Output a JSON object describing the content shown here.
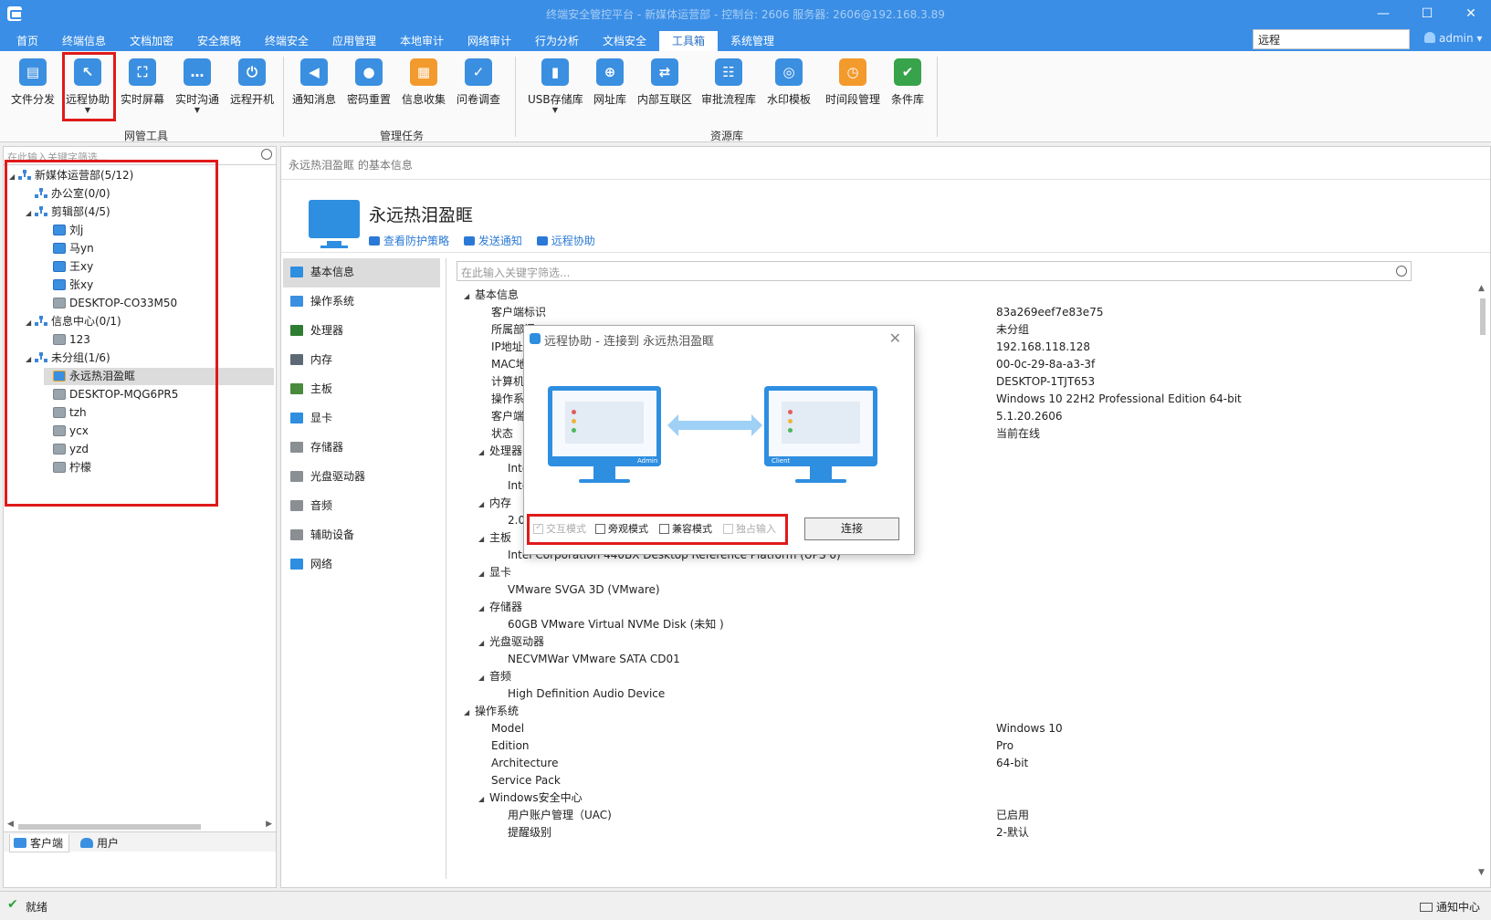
{
  "window": {
    "title": "终端安全管控平台 - 新媒体运营部 - 控制台: 2606 服务器: 2606@192.168.3.89"
  },
  "menu": {
    "tabs": [
      {
        "label": "首页",
        "active": false
      },
      {
        "label": "终端信息",
        "active": false
      },
      {
        "label": "文档加密",
        "active": false
      },
      {
        "label": "安全策略",
        "active": false
      },
      {
        "label": "终端安全",
        "active": false
      },
      {
        "label": "应用管理",
        "active": false
      },
      {
        "label": "本地审计",
        "active": false
      },
      {
        "label": "网络审计",
        "active": false
      },
      {
        "label": "行为分析",
        "active": false
      },
      {
        "label": "文档安全",
        "active": false
      },
      {
        "label": "工具箱",
        "active": true
      },
      {
        "label": "系统管理",
        "active": false
      }
    ],
    "search_value": "远程",
    "user": "admin"
  },
  "ribbon": {
    "buttons": [
      {
        "label": "文件分发",
        "icon": "file-send-icon",
        "color": "#3b8fe0"
      },
      {
        "label": "远程协助",
        "icon": "remote-assist-icon",
        "color": "#3b8fe0"
      },
      {
        "label": "实时屏幕",
        "icon": "screen-icon",
        "color": "#3b8fe0"
      },
      {
        "label": "实时沟通",
        "icon": "chat-icon",
        "color": "#3b8fe0"
      },
      {
        "label": "远程开机",
        "icon": "power-icon",
        "color": "#3b8fe0"
      },
      {
        "label": "通知消息",
        "icon": "megaphone-icon",
        "color": "#3b8fe0"
      },
      {
        "label": "密码重置",
        "icon": "lock-icon",
        "color": "#3b8fe0"
      },
      {
        "label": "信息收集",
        "icon": "collect-icon",
        "color": "#f39a2d"
      },
      {
        "label": "问卷调查",
        "icon": "survey-icon",
        "color": "#3b8fe0"
      },
      {
        "label": "USB存储库",
        "icon": "usb-icon",
        "color": "#3b8fe0"
      },
      {
        "label": "网址库",
        "icon": "globe-icon",
        "color": "#3b8fe0"
      },
      {
        "label": "内部互联区",
        "icon": "network-icon",
        "color": "#3b8fe0"
      },
      {
        "label": "审批流程库",
        "icon": "flow-icon",
        "color": "#3b8fe0"
      },
      {
        "label": "水印模板",
        "icon": "watermark-icon",
        "color": "#3b8fe0"
      },
      {
        "label": "时间段管理",
        "icon": "clock-icon",
        "color": "#f39a2d"
      },
      {
        "label": "条件库",
        "icon": "condition-icon",
        "color": "#37a34a"
      }
    ],
    "groups": [
      "网管工具",
      "管理任务",
      "资源库"
    ]
  },
  "left_panel": {
    "search_placeholder": "在此输入关键字筛选...",
    "tree": [
      {
        "label": "新媒体运营部(5/12)"
      },
      {
        "label": "办公室(0/0)"
      },
      {
        "label": "剪辑部(4/5)"
      },
      {
        "label": "刘j"
      },
      {
        "label": "马yn"
      },
      {
        "label": "王xy"
      },
      {
        "label": "张xy"
      },
      {
        "label": "DESKTOP-CO33M50"
      },
      {
        "label": "信息中心(0/1)"
      },
      {
        "label": "123"
      },
      {
        "label": "未分组(1/6)"
      },
      {
        "label": "永远热泪盈眶"
      },
      {
        "label": "DESKTOP-MQG6PR5"
      },
      {
        "label": "tzh"
      },
      {
        "label": "ycx"
      },
      {
        "label": "yzd"
      },
      {
        "label": "柠檬"
      }
    ],
    "tabs": [
      "客户端",
      "用户"
    ]
  },
  "content": {
    "breadcrumb": "永远热泪盈眶 的基本信息",
    "device_name": "永远热泪盈眶",
    "links": [
      "查看防护策略",
      "发送通知",
      "远程协助"
    ],
    "categories": [
      "基本信息",
      "操作系统",
      "处理器",
      "内存",
      "主板",
      "显卡",
      "存储器",
      "光盘驱动器",
      "音频",
      "辅助设备",
      "网络"
    ],
    "filter_placeholder": "在此输入关键字筛选...",
    "props": [
      {
        "key": "基本信息",
        "value": ""
      },
      {
        "key": "客户端标识",
        "value": "83a269eef7e83e75"
      },
      {
        "key": "所属部门",
        "value": "未分组"
      },
      {
        "key": "IP地址",
        "value": "192.168.118.128"
      },
      {
        "key": "MAC地址",
        "value": "00-0c-29-8a-a3-3f"
      },
      {
        "key": "计算机名",
        "value": "DESKTOP-1TJT653"
      },
      {
        "key": "操作系统",
        "value": "Windows 10 22H2 Professional Edition 64-bit"
      },
      {
        "key": "客户端版本",
        "value": "5.1.20.2606"
      },
      {
        "key": "状态",
        "value": "当前在线"
      },
      {
        "key": "处理器",
        "value": ""
      },
      {
        "key": "Intel",
        "value": ""
      },
      {
        "key": "Intel",
        "value": ""
      },
      {
        "key": "内存",
        "value": ""
      },
      {
        "key": "2.0",
        "value": ""
      },
      {
        "key": "主板",
        "value": ""
      },
      {
        "key": "Intel Corporation 440BX Desktop Reference Platform (UPS 0)",
        "value": ""
      },
      {
        "key": "显卡",
        "value": ""
      },
      {
        "key": "VMware SVGA 3D (VMware)",
        "value": ""
      },
      {
        "key": "存储器",
        "value": ""
      },
      {
        "key": "60GB VMware Virtual NVMe Disk (未知 )",
        "value": ""
      },
      {
        "key": "光盘驱动器",
        "value": ""
      },
      {
        "key": "NECVMWar VMware SATA CD01",
        "value": ""
      },
      {
        "key": "音频",
        "value": ""
      },
      {
        "key": "High Definition Audio Device",
        "value": ""
      },
      {
        "key": "操作系统",
        "value": ""
      },
      {
        "key": "Model",
        "value": "Windows 10"
      },
      {
        "key": "Edition",
        "value": "Pro"
      },
      {
        "key": "Architecture",
        "value": "64-bit"
      },
      {
        "key": "Service Pack",
        "value": ""
      },
      {
        "key": "Windows安全中心",
        "value": ""
      },
      {
        "key": "用户账户管理（UAC)",
        "value": "已启用"
      },
      {
        "key": "提醒级别",
        "value": "2-默认"
      }
    ]
  },
  "dialog": {
    "title": "远程协助 - 连接到 永远热泪盈眶",
    "admin_label": "Admin",
    "client_label": "Client",
    "options": [
      {
        "label": "交互模式",
        "checked": true,
        "disabled": true
      },
      {
        "label": "旁观模式",
        "checked": false,
        "disabled": false
      },
      {
        "label": "兼容模式",
        "checked": false,
        "disabled": false
      },
      {
        "label": "独占输入",
        "checked": false,
        "disabled": true
      }
    ],
    "connect_label": "连接"
  },
  "status": {
    "text": "就绪",
    "notif": "通知中心"
  },
  "colors": {
    "accent": "#3a8ee6",
    "highlight": "#e01a1a",
    "online": "#2aa33a"
  }
}
